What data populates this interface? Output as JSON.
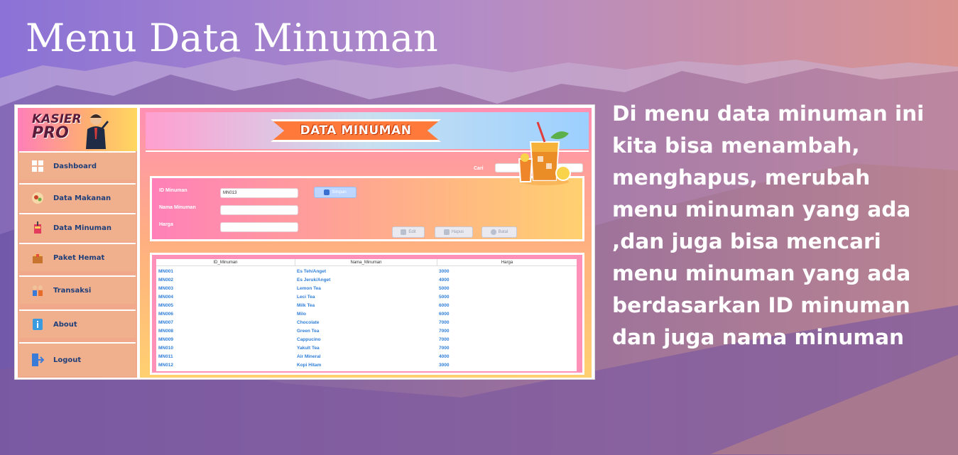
{
  "slide": {
    "title": "Menu Data Minuman",
    "description_lines": [
      "Di menu data minuman ini",
      "kita bisa menambah,",
      "menghapus, merubah",
      "menu minuman yang ada",
      ",dan juga bisa mencari",
      "menu minuman yang ada",
      "berdasarkan ID minuman",
      "dan juga nama minuman"
    ]
  },
  "app": {
    "logo": {
      "line1": "KASIER",
      "line2": "PRO"
    },
    "sidebar": [
      {
        "label": "Dashboard",
        "icon": "dashboard-icon"
      },
      {
        "label": "Data Makanan",
        "icon": "food-icon"
      },
      {
        "label": "Data Minuman",
        "icon": "drink-icon"
      },
      {
        "label": "Paket Hemat",
        "icon": "package-icon"
      },
      {
        "label": "Transaksi",
        "icon": "transaction-icon"
      },
      {
        "label": "About",
        "icon": "info-icon"
      },
      {
        "label": "Logout",
        "icon": "logout-icon"
      }
    ],
    "banner_title": "DATA MINUMAN",
    "search": {
      "label": "Cari",
      "value": ""
    },
    "form": {
      "id_label": "ID Minuman",
      "id_value": "MN013",
      "name_label": "Nama Minuman",
      "name_value": "",
      "price_label": "Harga",
      "price_value": "",
      "save_label": "Simpan",
      "edit_label": "Edit",
      "delete_label": "Hapus",
      "cancel_label": "Batal"
    },
    "table": {
      "columns": [
        "ID_Minuman",
        "Nama_Minuman",
        "Harga"
      ],
      "rows": [
        [
          "MN001",
          "Es Teh/Anget",
          "3000"
        ],
        [
          "MN002",
          "Es Jeruk/Anget",
          "4000"
        ],
        [
          "MN003",
          "Lemon Tea",
          "5000"
        ],
        [
          "MN004",
          "Leci Tea",
          "5000"
        ],
        [
          "MN005",
          "Milk Tea",
          "6000"
        ],
        [
          "MN006",
          "Milo",
          "6000"
        ],
        [
          "MN007",
          "Chocolate",
          "7000"
        ],
        [
          "MN008",
          "Green Tea",
          "7000"
        ],
        [
          "MN009",
          "Cappucino",
          "7000"
        ],
        [
          "MN010",
          "Yakult Tea",
          "7000"
        ],
        [
          "MN011",
          "Air Mineral",
          "4000"
        ],
        [
          "MN012",
          "Kopi Hitam",
          "3000"
        ]
      ]
    }
  },
  "colors": {
    "banner": "#ff7a3a",
    "table_text": "#2f7ed8",
    "sidebar": "#f1b08d"
  }
}
